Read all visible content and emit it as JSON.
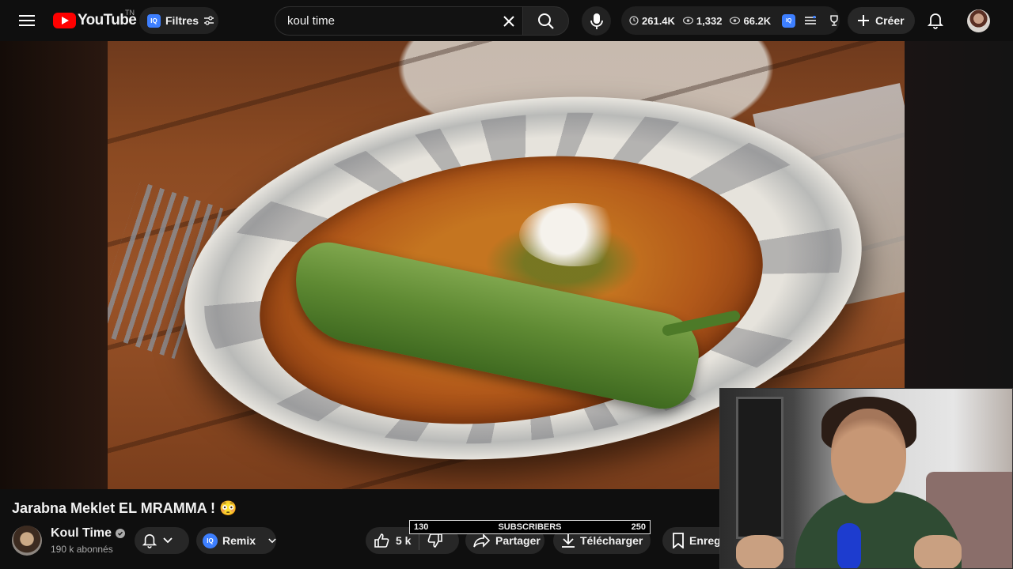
{
  "header": {
    "logo_text": "YouTube",
    "country_code": "TN",
    "filters_label": "Filtres",
    "iq_badge": "IQ",
    "search": {
      "value": "koul time",
      "placeholder": ""
    },
    "stats": {
      "time": "261.4K",
      "views": "1,332",
      "visible": "66.2K"
    },
    "create_label": "Créer",
    "icons": [
      "menu-icon",
      "filter-icon",
      "close-icon",
      "search-icon",
      "mic-icon",
      "clock-icon",
      "eye-icon",
      "list-icon",
      "trophy-icon",
      "plus-icon",
      "bell-icon"
    ]
  },
  "video": {
    "title": "Jarabna Meklet EL MRAMMA ! 😳",
    "channel": {
      "name": "Koul Time",
      "subscribers": "190 k abonnés"
    },
    "actions": {
      "remix": "Remix",
      "likes": "5 k",
      "share": "Partager",
      "download": "Télécharger",
      "save": "Enreg"
    },
    "subscriber_goal": {
      "start": "130",
      "label": "SUBSCRIBERS",
      "end": "250"
    }
  },
  "colors": {
    "accent": "#ff0000",
    "iq_blue": "#3d7fff",
    "background": "#0f0f0f"
  }
}
